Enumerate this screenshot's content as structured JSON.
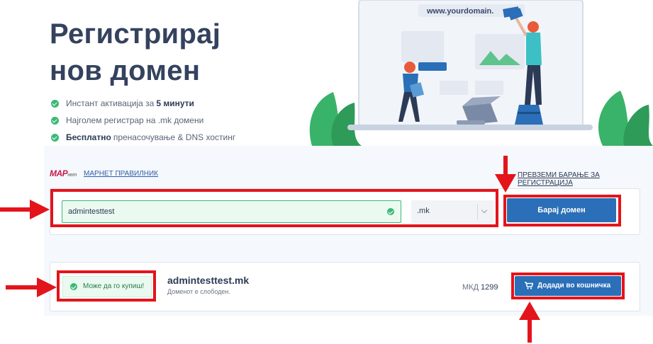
{
  "hero": {
    "title_line1": "Регистрирај",
    "title_line2": "нов домен",
    "features": [
      {
        "prefix": "Инстант активација за",
        "bold": "5 минути",
        "suffix": ""
      },
      {
        "prefix": "Најголем регистрар на .mk домени",
        "bold": "",
        "suffix": ""
      },
      {
        "prefix": "",
        "bold": "Бесплатно",
        "suffix": "пренасочување & DNS хостинг"
      }
    ],
    "illustration_text": "www.yourdomain."
  },
  "search": {
    "marnet_logo": "MAP",
    "marnet_logo_small": "нет",
    "marnet_link": "МАРНЕТ ПРАВИЛНИК",
    "download_link": "ПРЕВЗЕМИ БАРАЊЕ ЗА РЕГИСТРАЦИЈА",
    "domain_value": "admintesttest",
    "tld_value": ".mk",
    "search_button": "Барај домен"
  },
  "result": {
    "status_text": "Може да го купиш!",
    "domain": "admintesttest.mk",
    "subtitle": "Доменот е слободен.",
    "currency": "МКД",
    "price": "1299",
    "cart_button": "Додади во кошничка"
  },
  "colors": {
    "primary": "#2a6fb7",
    "success": "#3cb878",
    "annotation_red": "#e3141b",
    "title": "#34425e"
  },
  "icons": [
    "check-circle-icon",
    "chevron-down-icon",
    "cart-icon",
    "arrow-right-icon",
    "arrow-down-icon",
    "arrow-up-icon"
  ]
}
